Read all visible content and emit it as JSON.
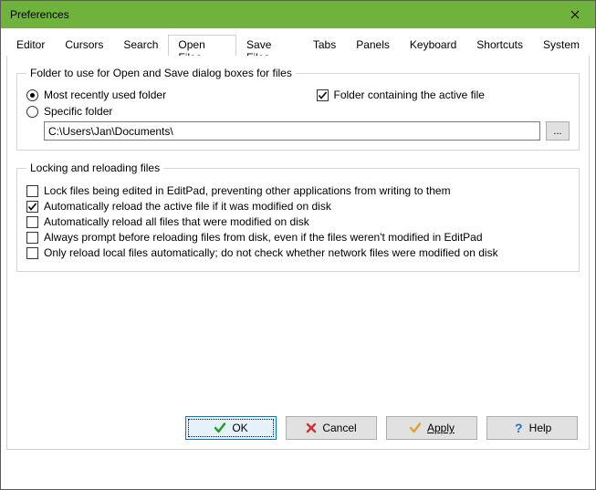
{
  "window": {
    "title": "Preferences"
  },
  "tabs": {
    "editor": "Editor",
    "cursors": "Cursors",
    "search": "Search",
    "open_files": "Open Files",
    "save_files": "Save Files",
    "tabs": "Tabs",
    "panels": "Panels",
    "keyboard": "Keyboard",
    "shortcuts": "Shortcuts",
    "system": "System"
  },
  "folder_group": {
    "legend": "Folder to use for Open and Save dialog boxes for files",
    "mru": "Most recently used folder",
    "active": "Folder containing the active file",
    "specific": "Specific folder",
    "path": "C:\\Users\\Jan\\Documents\\",
    "browse": "..."
  },
  "lock_group": {
    "legend": "Locking and reloading files",
    "lock": "Lock files being edited in EditPad, preventing other applications from writing to them",
    "auto_active": "Automatically reload the active file if it was modified on disk",
    "auto_all": "Automatically reload all files that were modified on disk",
    "always_prompt": "Always prompt before reloading files from disk, even if the files weren't modified in EditPad",
    "local_only": "Only reload local files automatically; do not check whether network files were modified on disk"
  },
  "buttons": {
    "ok": "OK",
    "cancel": "Cancel",
    "apply": "Apply",
    "help": "Help"
  }
}
